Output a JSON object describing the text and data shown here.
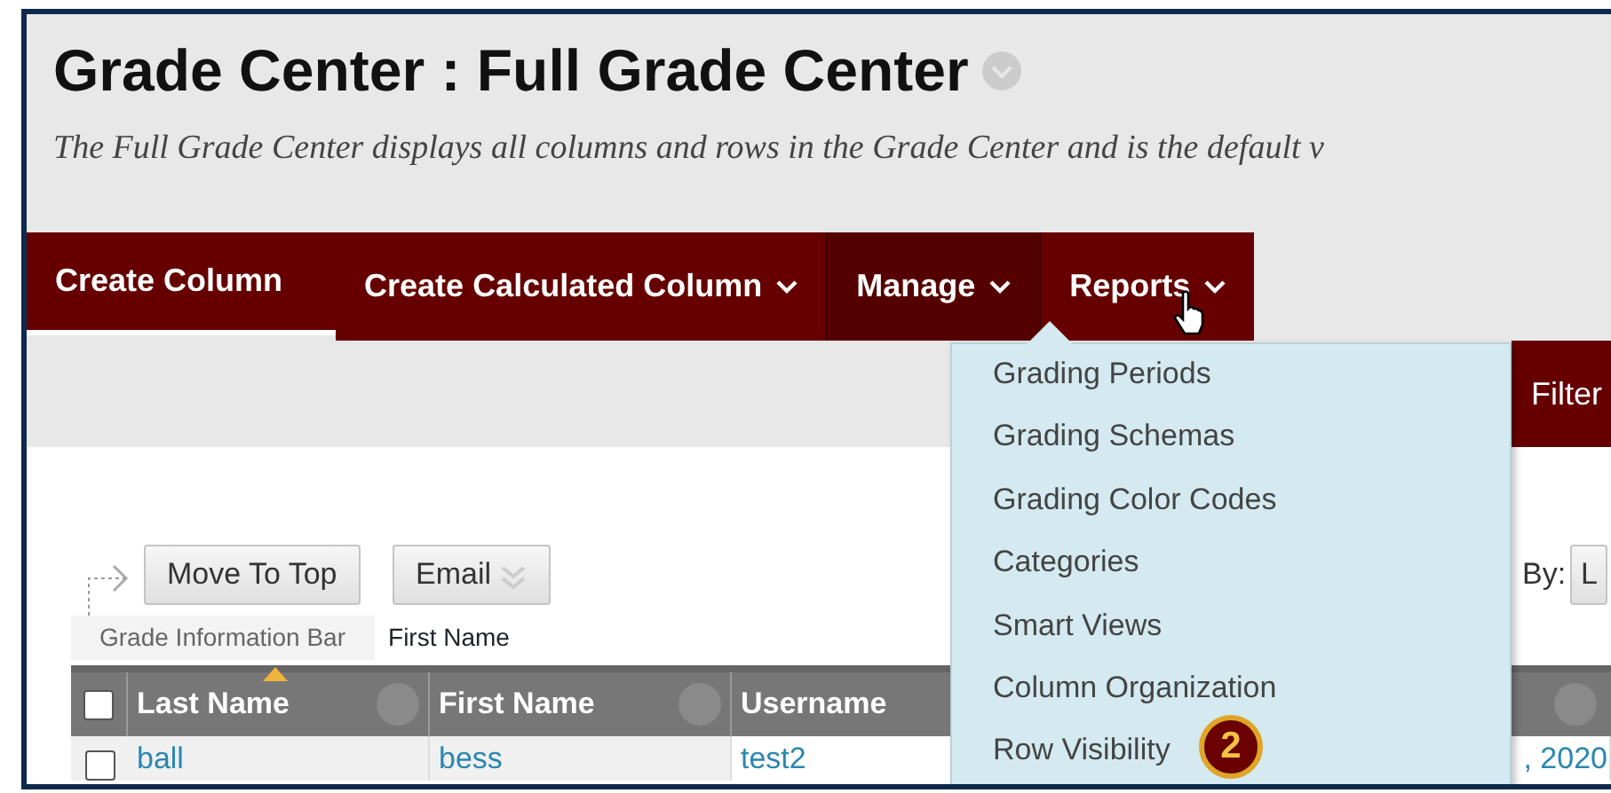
{
  "page": {
    "title": "Grade Center : Full Grade Center",
    "description": "The Full Grade Center displays all columns and rows in the Grade Center and is the default v"
  },
  "action_bar": [
    {
      "label": "Create Column",
      "has_menu": false,
      "selected": false
    },
    {
      "label": "Create Calculated Column",
      "has_menu": true,
      "selected": false
    },
    {
      "label": "Manage",
      "has_menu": true,
      "selected": true
    },
    {
      "label": "Reports",
      "has_menu": true,
      "selected": false
    }
  ],
  "manage_menu": [
    "Grading Periods",
    "Grading Schemas",
    "Grading Color Codes",
    "Categories",
    "Smart Views",
    "Column Organization",
    "Row Visibility"
  ],
  "step_badge": "2",
  "filter_button": "Filter",
  "sort_label": "By:",
  "sort_select": "L",
  "table_buttons": [
    "Move To Top",
    "Email"
  ],
  "info_bar": {
    "label": "Grade Information Bar",
    "value": "First Name"
  },
  "table": {
    "all_checked": false,
    "columns": [
      {
        "label": "Last Name",
        "sorted": true
      },
      {
        "label": "First Name",
        "sorted": false
      },
      {
        "label": "Username",
        "sorted": false
      }
    ],
    "rows": [
      {
        "checked": false,
        "cells": [
          "ball",
          "bess",
          "test2"
        ],
        "column_far": ", 2020"
      }
    ]
  }
}
